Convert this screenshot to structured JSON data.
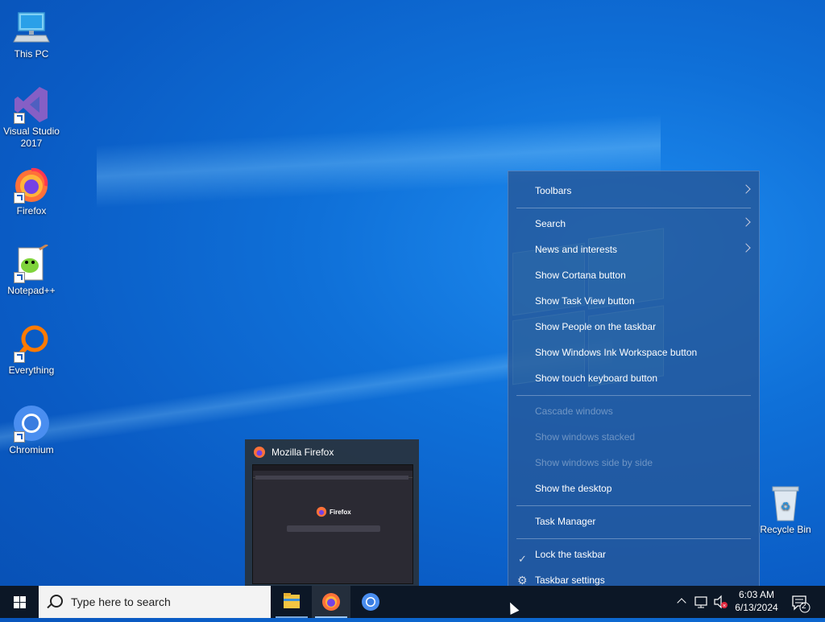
{
  "desktop": {
    "icons": [
      {
        "label": "This PC"
      },
      {
        "label": "Visual Studio 2017"
      },
      {
        "label": "Firefox"
      },
      {
        "label": "Notepad++"
      },
      {
        "label": "Everything"
      },
      {
        "label": "Chromium"
      },
      {
        "label": "Recycle Bin"
      }
    ]
  },
  "preview": {
    "title": "Mozilla Firefox",
    "brand": "Firefox"
  },
  "context_menu": {
    "items": [
      {
        "label": "Toolbars",
        "submenu": true
      },
      {
        "label": "Search",
        "submenu": true
      },
      {
        "label": "News and interests",
        "submenu": true
      },
      {
        "label": "Show Cortana button"
      },
      {
        "label": "Show Task View button"
      },
      {
        "label": "Show People on the taskbar"
      },
      {
        "label": "Show Windows Ink Workspace button"
      },
      {
        "label": "Show touch keyboard button"
      },
      {
        "label": "Cascade windows",
        "disabled": true
      },
      {
        "label": "Show windows stacked",
        "disabled": true
      },
      {
        "label": "Show windows side by side",
        "disabled": true
      },
      {
        "label": "Show the desktop"
      },
      {
        "label": "Task Manager"
      },
      {
        "label": "Lock the taskbar",
        "checked": true
      },
      {
        "label": "Taskbar settings",
        "icon": "gear-icon"
      }
    ]
  },
  "taskbar": {
    "search_placeholder": "Type here to search",
    "pinned": [
      "file-explorer-icon",
      "firefox-icon",
      "chromium-icon"
    ],
    "clock_time": "6:03 AM",
    "clock_date": "6/13/2024",
    "notification_count": "2"
  },
  "colors": {
    "taskbar": "#0c1726",
    "menu_bg": "#265696",
    "desktop": "#0a5bc4"
  }
}
